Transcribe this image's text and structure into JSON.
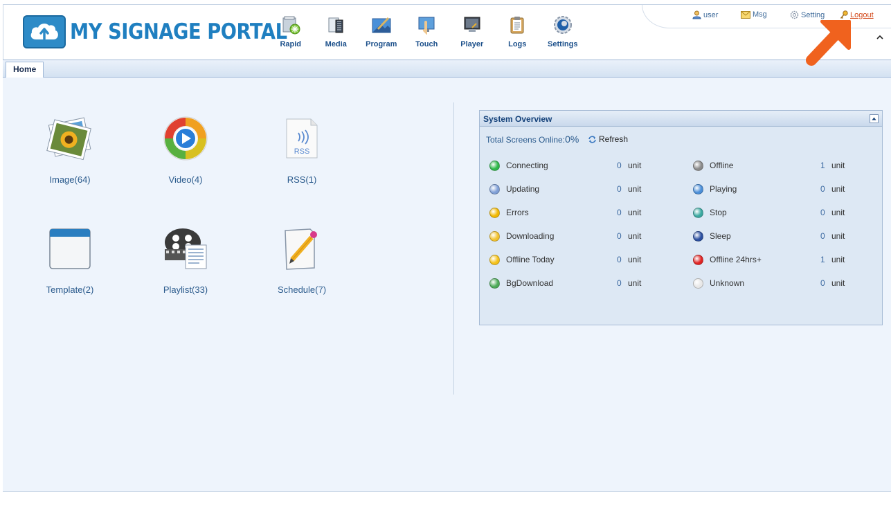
{
  "brand": {
    "name": "MY SIGNAGE PORTAL"
  },
  "topnav": [
    {
      "label": "Rapid",
      "icon": "rapid-icon"
    },
    {
      "label": "Media",
      "icon": "media-icon"
    },
    {
      "label": "Program",
      "icon": "program-icon"
    },
    {
      "label": "Touch",
      "icon": "touch-icon"
    },
    {
      "label": "Player",
      "icon": "player-icon"
    },
    {
      "label": "Logs",
      "icon": "logs-icon"
    },
    {
      "label": "Settings",
      "icon": "settings-icon"
    }
  ],
  "userbar": {
    "user": "user",
    "msg": "Msg",
    "setting": "Setting",
    "logout": "Logout"
  },
  "tabs": [
    {
      "label": "Home"
    }
  ],
  "modules": [
    {
      "label": "Image(64)",
      "icon": "image-icon"
    },
    {
      "label": "Video(4)",
      "icon": "video-icon"
    },
    {
      "label": "RSS(1)",
      "icon": "rss-icon"
    },
    {
      "label": "Template(2)",
      "icon": "template-icon"
    },
    {
      "label": "Playlist(33)",
      "icon": "playlist-icon"
    },
    {
      "label": "Schedule(7)",
      "icon": "schedule-icon"
    }
  ],
  "overview": {
    "title": "System Overview",
    "total_label": "Total Screens Online:",
    "total_value": "0%",
    "refresh": "Refresh",
    "left": [
      {
        "label": "Connecting",
        "count": "0",
        "unit": "unit",
        "color": "#2fb84a"
      },
      {
        "label": "Updating",
        "count": "0",
        "unit": "unit",
        "color": "#7f9fd6"
      },
      {
        "label": "Errors",
        "count": "0",
        "unit": "unit",
        "color": "#f2b800"
      },
      {
        "label": "Downloading",
        "count": "0",
        "unit": "unit",
        "color": "#f2c22e"
      },
      {
        "label": "Offline Today",
        "count": "0",
        "unit": "unit",
        "color": "#f5c21a"
      },
      {
        "label": "BgDownload",
        "count": "0",
        "unit": "unit",
        "color": "#4caa58"
      }
    ],
    "right": [
      {
        "label": "Offline",
        "count": "1",
        "unit": "unit",
        "color": "#8a8a8a"
      },
      {
        "label": "Playing",
        "count": "0",
        "unit": "unit",
        "color": "#4a8ed8"
      },
      {
        "label": "Stop",
        "count": "0",
        "unit": "unit",
        "color": "#3aa8a0"
      },
      {
        "label": "Sleep",
        "count": "0",
        "unit": "unit",
        "color": "#2b4fa0"
      },
      {
        "label": "Offline 24hrs+",
        "count": "1",
        "unit": "unit",
        "color": "#e02424"
      },
      {
        "label": "Unknown",
        "count": "0",
        "unit": "unit",
        "color": "#e8e8e8"
      }
    ]
  },
  "colors": {
    "accent": "#1f7fc0",
    "logout": "#d34a1c",
    "annotation_arrow": "#f0621e"
  }
}
